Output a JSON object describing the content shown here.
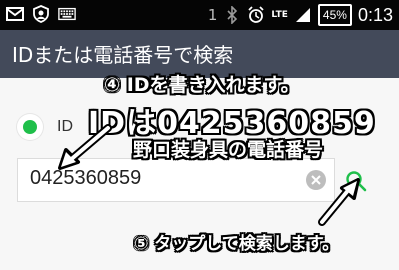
{
  "status_bar": {
    "sim_indicator": "1",
    "network_label": "LTE",
    "battery_text": "45%",
    "time": "0:13",
    "icons": [
      "mail-icon",
      "shield-icon",
      "keyboard-icon",
      "bluetooth-icon",
      "alarm-icon",
      "signal-icon"
    ]
  },
  "app_bar": {
    "title": "IDまたは電話番号で検索"
  },
  "search_type": {
    "selected_option": "ID",
    "accent_color": "#1fbf4a"
  },
  "search_field": {
    "value": "0425360859"
  },
  "annotations": {
    "step4": "④ IDを書き入れます。",
    "id_text": "IDは0425360859",
    "owner_text": "野口装身具の電話番号",
    "step5": "⑤ タップして検索します。"
  },
  "colors": {
    "app_bar_bg": "#434a5a",
    "status_bar_bg": "#050505",
    "search_icon": "#1fbf4a"
  }
}
